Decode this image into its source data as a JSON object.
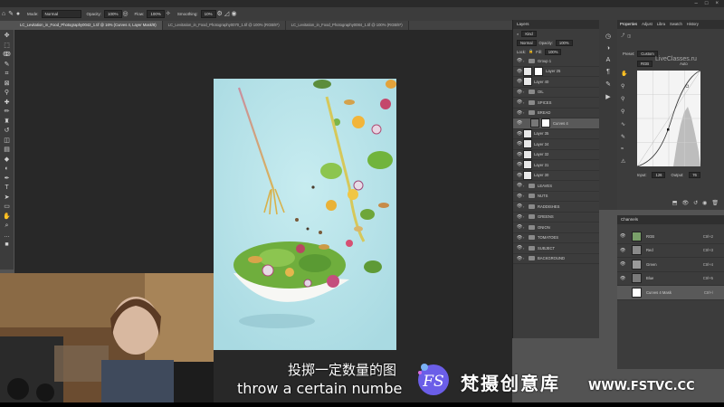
{
  "options_bar": {
    "mode_label": "Mode:",
    "mode_value": "Normal",
    "opacity_label": "Opacity:",
    "opacity_value": "100%",
    "flow_label": "Flow:",
    "flow_value": "100%",
    "smoothing_label": "Smoothing:",
    "smoothing_value": "10%"
  },
  "tabs": [
    {
      "label": "LC_Levitation_in_Food_Photography0042_1.tif @ 16% (Curves 4, Layer Mask/8)"
    },
    {
      "label": "LC_Levitation_in_Food_Photography0070_1.tif @ 100% (RGB/8*)"
    },
    {
      "label": "LC_Levitation_in_Food_Photography0084_1.tif @ 100% (RGB/8*)"
    }
  ],
  "layers_panel": {
    "title": "Layers",
    "kind": "Kind",
    "blend": "Normal",
    "opacity_label": "Opacity:",
    "opacity_value": "100%",
    "lock_label": "Lock:",
    "fill_label": "Fill:",
    "fill_value": "100%",
    "layers": [
      {
        "name": "Group 1",
        "type": "group"
      },
      {
        "name": "Layer 25",
        "type": "layer"
      },
      {
        "name": "Layer 40",
        "type": "layer"
      },
      {
        "name": "OIL",
        "type": "group"
      },
      {
        "name": "SPICES",
        "type": "group"
      },
      {
        "name": "BREAD",
        "type": "group"
      },
      {
        "name": "Curves 4",
        "type": "adjust"
      },
      {
        "name": "Layer 35",
        "type": "layer"
      },
      {
        "name": "Layer 34",
        "type": "layer"
      },
      {
        "name": "Layer 32",
        "type": "layer"
      },
      {
        "name": "Layer 31",
        "type": "layer"
      },
      {
        "name": "Layer 30",
        "type": "layer"
      },
      {
        "name": "LEAVES",
        "type": "group"
      },
      {
        "name": "NUTS",
        "type": "group"
      },
      {
        "name": "RADDISHES",
        "type": "group"
      },
      {
        "name": "GREENS",
        "type": "group"
      },
      {
        "name": "ONION",
        "type": "group"
      },
      {
        "name": "TOMATOES",
        "type": "group"
      },
      {
        "name": "SUBJECT",
        "type": "group"
      },
      {
        "name": "BACKGROUND",
        "type": "group"
      }
    ]
  },
  "properties": {
    "tabs": [
      "Properties",
      "Adjust",
      "Libra",
      "Swatch",
      "History"
    ],
    "preset_label": "Preset:",
    "preset_value": "Custom",
    "channel_value": "RGB",
    "auto_label": "Auto",
    "input_label": "Input:",
    "input_value": "126",
    "output_label": "Output:",
    "output_value": "76",
    "watermark": "LiveClasses.ru"
  },
  "channels": {
    "title": "Channels",
    "rows": [
      {
        "name": "RGB",
        "shortcut": "Ctrl+2"
      },
      {
        "name": "Red",
        "shortcut": "Ctrl+3"
      },
      {
        "name": "Green",
        "shortcut": "Ctrl+4"
      },
      {
        "name": "Blue",
        "shortcut": "Ctrl+5"
      },
      {
        "name": "Curves 4 Mask",
        "shortcut": "Ctrl+\\"
      }
    ]
  },
  "subtitles": {
    "chinese": "投掷一定数量的图",
    "english": "throw a certain numbe"
  },
  "brand": {
    "logo_text": "FS",
    "name": "梵摄创意库",
    "site": "WWW.FSTVC.CC"
  }
}
